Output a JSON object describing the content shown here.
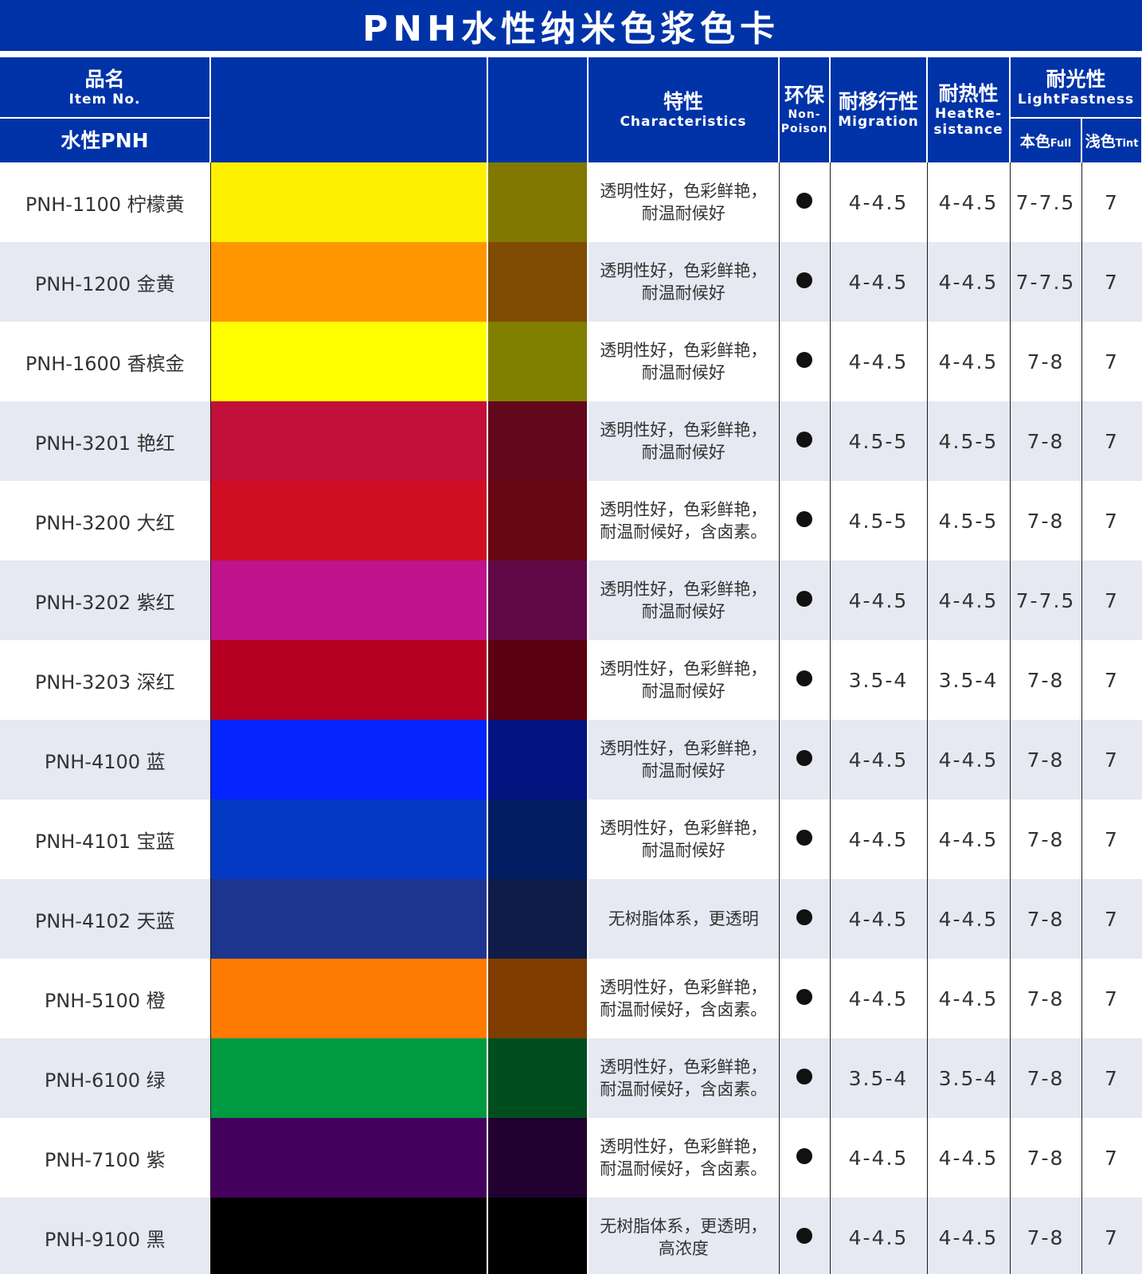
{
  "title": "PNH水性纳米色浆色卡",
  "headers": {
    "item_zh": "品名",
    "item_en": "Item No.",
    "item_series": "水性PNH",
    "characteristics_zh": "特性",
    "characteristics_en": "Characteristics",
    "nonpoison_zh": "环保",
    "nonpoison_en_1": "Non-",
    "nonpoison_en_2": "Poison",
    "migration_zh": "耐移行性",
    "migration_en": "Migration",
    "heat_zh": "耐热性",
    "heat_en_1": "HeatRe-",
    "heat_en_2": "sistance",
    "light_zh": "耐光性",
    "light_en": "LightFastness",
    "full_zh": "本色",
    "full_en": "Full",
    "tint_zh": "浅色",
    "tint_en": "Tint"
  },
  "icons": {
    "nonpoison_mark": "filled-circle-icon"
  },
  "rows": [
    {
      "name": "PNH-1100 柠檬黄",
      "full_color": "#fff000",
      "tint_color": "#807800",
      "feat1": "透明性好，色彩鲜艳，",
      "feat2": "耐温耐候好",
      "migration": "4-4.5",
      "heat": "4-4.5",
      "light_full": "7-7.5",
      "light_tint": "7"
    },
    {
      "name": "PNH-1200 金黄",
      "full_color": "#ff9600",
      "tint_color": "#7f4b00",
      "feat1": "透明性好，色彩鲜艳，",
      "feat2": "耐温耐候好",
      "migration": "4-4.5",
      "heat": "4-4.5",
      "light_full": "7-7.5",
      "light_tint": "7"
    },
    {
      "name": "PNH-1600 香槟金",
      "full_color": "#ffff00",
      "tint_color": "#807f00",
      "feat1": "透明性好，色彩鲜艳，",
      "feat2": "耐温耐候好",
      "migration": "4-4.5",
      "heat": "4-4.5",
      "light_full": "7-8",
      "light_tint": "7"
    },
    {
      "name": "PNH-3201 艳红",
      "full_color": "#c3103a",
      "tint_color": "#62081d",
      "feat1": "透明性好，色彩鲜艳，",
      "feat2": "耐温耐候好",
      "migration": "4.5-5",
      "heat": "4.5-5",
      "light_full": "7-8",
      "light_tint": "7"
    },
    {
      "name": "PNH-3200 大红",
      "full_color": "#cf0e23",
      "tint_color": "#670712",
      "feat1": "透明性好，色彩鲜艳，",
      "feat2": "耐温耐候好，含卤素。",
      "migration": "4.5-5",
      "heat": "4.5-5",
      "light_full": "7-8",
      "light_tint": "7"
    },
    {
      "name": "PNH-3202 紫红",
      "full_color": "#c1128e",
      "tint_color": "#600947",
      "feat1": "透明性好，色彩鲜艳，",
      "feat2": "耐温耐候好",
      "migration": "4-4.5",
      "heat": "4-4.5",
      "light_full": "7-7.5",
      "light_tint": "7"
    },
    {
      "name": "PNH-3203 深红",
      "full_color": "#b50021",
      "tint_color": "#5b0010",
      "feat1": "透明性好，色彩鲜艳，",
      "feat2": "耐温耐候好",
      "migration": "3.5-4",
      "heat": "3.5-4",
      "light_full": "7-8",
      "light_tint": "7"
    },
    {
      "name": "PNH-4100 蓝",
      "full_color": "#0525ff",
      "tint_color": "#03137f",
      "feat1": "透明性好，色彩鲜艳，",
      "feat2": "耐温耐候好",
      "migration": "4-4.5",
      "heat": "4-4.5",
      "light_full": "7-8",
      "light_tint": "7"
    },
    {
      "name": "PNH-4101 宝蓝",
      "full_color": "#0339c3",
      "tint_color": "#021d62",
      "feat1": "透明性好，色彩鲜艳，",
      "feat2": "耐温耐候好",
      "migration": "4-4.5",
      "heat": "4-4.5",
      "light_full": "7-8",
      "light_tint": "7"
    },
    {
      "name": "PNH-4102 天蓝",
      "full_color": "#1e3590",
      "tint_color": "#0f1b48",
      "feat1": "无树脂体系，更透明",
      "feat2": "",
      "migration": "4-4.5",
      "heat": "4-4.5",
      "light_full": "7-8",
      "light_tint": "7"
    },
    {
      "name": "PNH-5100 橙",
      "full_color": "#ff7a00",
      "tint_color": "#7f3d00",
      "feat1": "透明性好，色彩鲜艳，",
      "feat2": "耐温耐候好，含卤素。",
      "migration": "4-4.5",
      "heat": "4-4.5",
      "light_full": "7-8",
      "light_tint": "7"
    },
    {
      "name": "PNH-6100 绿",
      "full_color": "#009b40",
      "tint_color": "#004e20",
      "feat1": "透明性好，色彩鲜艳，",
      "feat2": "耐温耐候好，含卤素。",
      "migration": "3.5-4",
      "heat": "3.5-4",
      "light_full": "7-8",
      "light_tint": "7"
    },
    {
      "name": "PNH-7100 紫",
      "full_color": "#45005e",
      "tint_color": "#220030",
      "feat1": "透明性好，色彩鲜艳，",
      "feat2": "耐温耐候好，含卤素。",
      "migration": "4-4.5",
      "heat": "4-4.5",
      "light_full": "7-8",
      "light_tint": "7"
    },
    {
      "name": "PNH-9100 黑",
      "full_color": "#000000",
      "tint_color": "#000000",
      "feat1": "无树脂体系，更透明，",
      "feat2": "高浓度",
      "migration": "4-4.5",
      "heat": "4-4.5",
      "light_full": "7-8",
      "light_tint": "7"
    }
  ]
}
